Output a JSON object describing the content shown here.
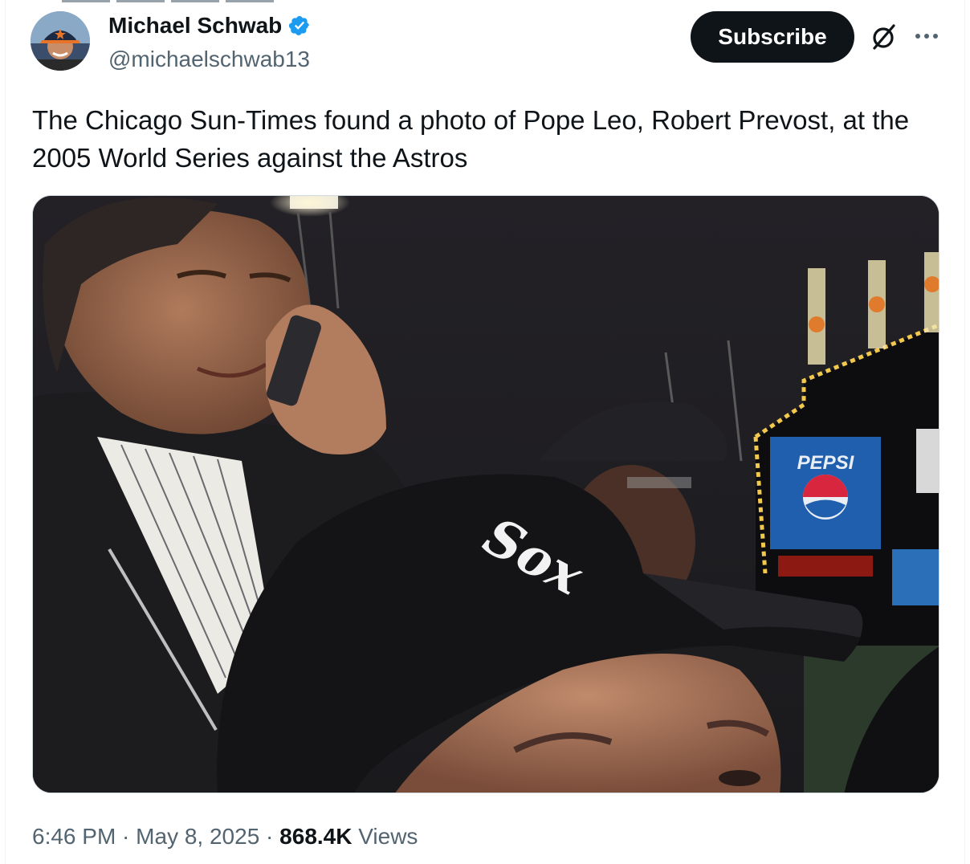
{
  "author": {
    "name": "Michael Schwab",
    "handle": "@michaelschwab13",
    "verified": true,
    "avatar_icon": "avatar-photo"
  },
  "actions": {
    "subscribe_label": "Subscribe",
    "grok_icon": "grok-icon",
    "more_icon": "more-dots-icon"
  },
  "tweet": {
    "text": "The Chicago Sun-Times found a photo of Pope Leo, Robert Prevost, at the 2005 World Series against the Astros"
  },
  "media": {
    "scoreboard_brand": "PEPSI",
    "cap_logo": "Sox"
  },
  "meta": {
    "time": "6:46 PM",
    "separator": " · ",
    "date": "May 8, 2025",
    "views_count": "868.4K",
    "views_label": " Views"
  },
  "colors": {
    "verified": "#1d9bf0",
    "subscribe_bg": "#0f1419",
    "secondary_text": "#536471"
  }
}
